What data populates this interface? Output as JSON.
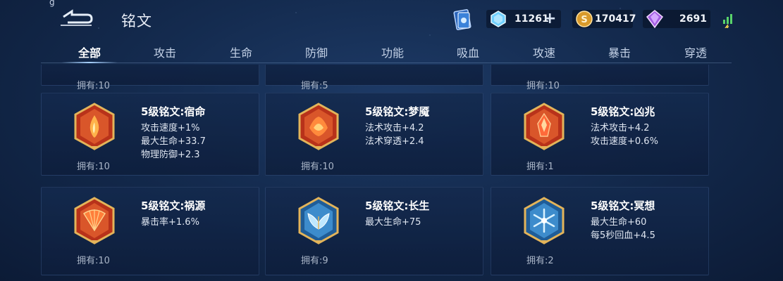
{
  "header": {
    "title": "铭文",
    "corner_glyph": "ǵ",
    "resources": {
      "diamond": "11261",
      "gold": "170417",
      "gem": "2691"
    }
  },
  "tabs": [
    "全部",
    "攻击",
    "生命",
    "防御",
    "功能",
    "吸血",
    "攻速",
    "暴击",
    "穿透"
  ],
  "active_tab": 0,
  "partial_row": [
    "拥有:10",
    "拥有:5",
    "拥有:10"
  ],
  "cards": [
    {
      "name": "5级铭文:宿命",
      "attrs": [
        "攻击速度+1%",
        "最大生命+33.7",
        "物理防御+2.3"
      ],
      "owned": "拥有:10",
      "color": "#c8431e",
      "icon": "flame-emblem-icon"
    },
    {
      "name": "5级铭文:梦魇",
      "attrs": [
        "法术攻击+4.2",
        "法术穿透+2.4"
      ],
      "owned": "拥有:10",
      "color": "#c8431e",
      "icon": "lotus-emblem-icon"
    },
    {
      "name": "5级铭文:凶兆",
      "attrs": [
        "法术攻击+4.2",
        "攻击速度+0.6%"
      ],
      "owned": "拥有:1",
      "color": "#c8431e",
      "icon": "crystal-emblem-icon"
    },
    {
      "name": "5级铭文:祸源",
      "attrs": [
        "暴击率+1.6%"
      ],
      "owned": "拥有:10",
      "color": "#c8431e",
      "icon": "fan-emblem-icon"
    },
    {
      "name": "5级铭文:长生",
      "attrs": [
        "最大生命+75"
      ],
      "owned": "拥有:9",
      "color": "#2f7fc0",
      "icon": "wing-emblem-icon"
    },
    {
      "name": "5级铭文:冥想",
      "attrs": [
        "最大生命+60",
        "每5秒回血+4.5"
      ],
      "owned": "拥有:2",
      "color": "#2f7fc0",
      "icon": "snowflake-emblem-icon"
    }
  ],
  "colors": {
    "accent_red": "#c8431e",
    "accent_blue": "#2f7fc0",
    "gold_frame": "#e3b45a",
    "background": "#142b4f"
  }
}
